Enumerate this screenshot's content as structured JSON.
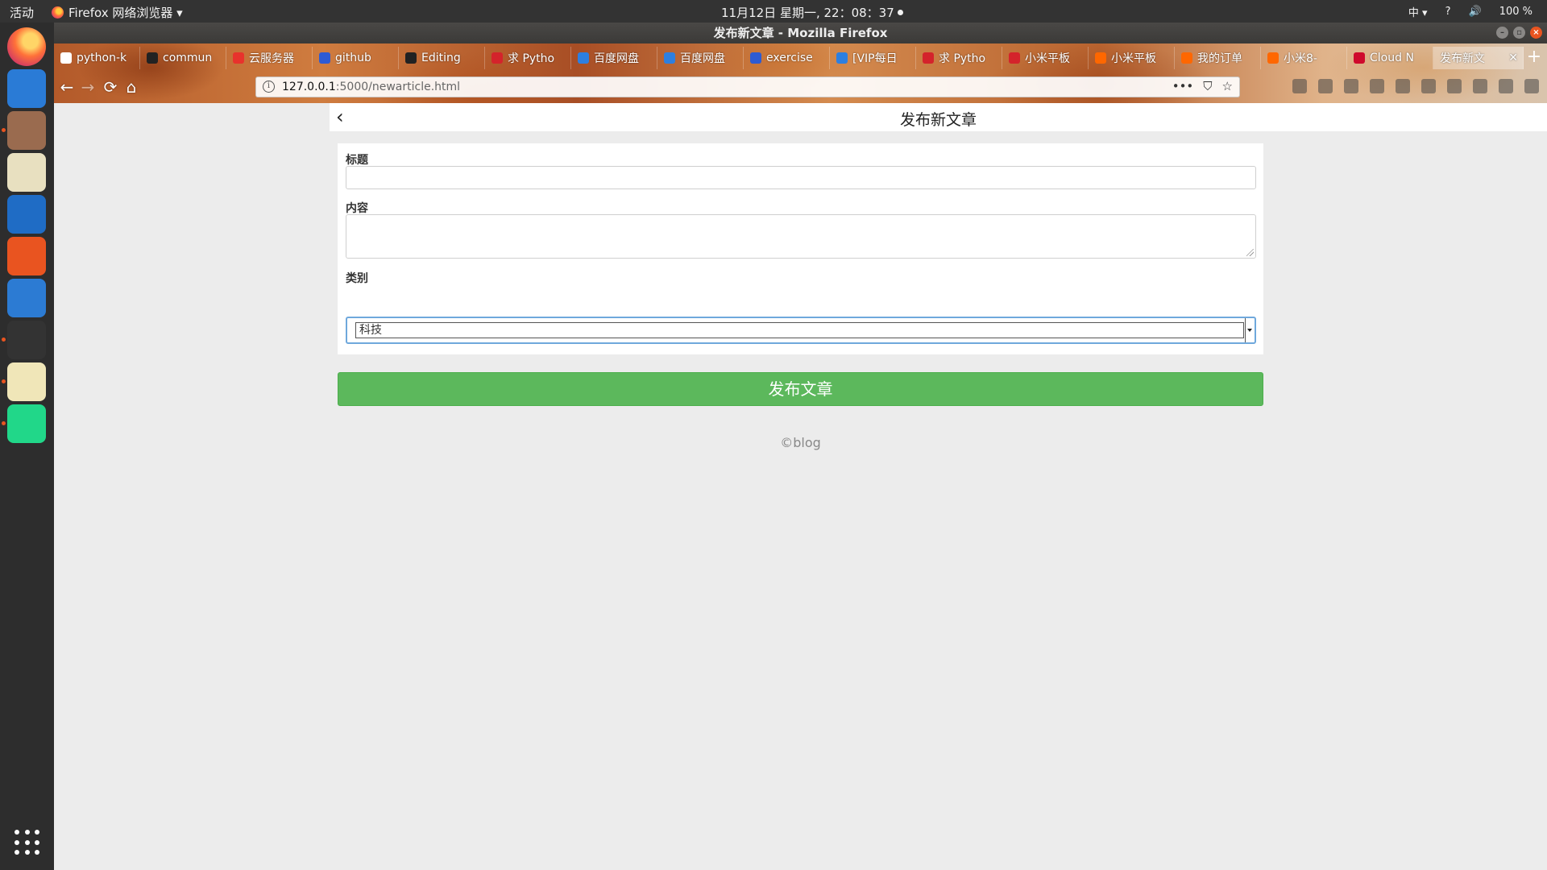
{
  "topbar": {
    "activities": "活动",
    "app_menu": "Firefox 网络浏览器 ▾",
    "clock": "11月12日 星期一, 22：08：37",
    "input_method": "中 ▾",
    "help": "?",
    "volume": "🔊",
    "battery": "100 %"
  },
  "window": {
    "title": "发布新文章 - Mozilla Firefox"
  },
  "tabs": [
    {
      "label": "python-k",
      "favicon_color": "#ffffff"
    },
    {
      "label": "commun",
      "favicon_color": "#222222"
    },
    {
      "label": "云服务器",
      "favicon_color": "#e8322c"
    },
    {
      "label": "github",
      "favicon_color": "#2d5bd3"
    },
    {
      "label": "Editing",
      "favicon_color": "#222222"
    },
    {
      "label": "求 Pytho",
      "favicon_color": "#d4232b"
    },
    {
      "label": "百度网盘",
      "favicon_color": "#2d7fe0"
    },
    {
      "label": "百度网盘",
      "favicon_color": "#2d7fe0"
    },
    {
      "label": "exercise",
      "favicon_color": "#2d5bd3"
    },
    {
      "label": "[VIP每日",
      "favicon_color": "#2d7fe0"
    },
    {
      "label": "求 Pytho",
      "favicon_color": "#d4232b"
    },
    {
      "label": "小米平板",
      "favicon_color": "#d4232b"
    },
    {
      "label": "小米平板",
      "favicon_color": "#ff6700"
    },
    {
      "label": "我的订单",
      "favicon_color": "#ff6700"
    },
    {
      "label": "小米8-",
      "favicon_color": "#ff6700"
    },
    {
      "label": "Cloud N",
      "favicon_color": "#cf0a2c"
    }
  ],
  "active_tab": {
    "label": "发布新文",
    "close": "✕"
  },
  "new_tab": "+",
  "nav": {
    "back": "←",
    "forward": "→",
    "reload": "⟳",
    "home": "⌂"
  },
  "url": {
    "host": "127.0.0.1",
    "path": ":5000/newarticle.html",
    "info": "i",
    "more": "•••",
    "pocket": "⛉",
    "bookmark": "☆"
  },
  "dock": [
    {
      "name": "firefox",
      "color": "#ff7139",
      "running": false
    },
    {
      "name": "thunderbird",
      "color": "#2a7bd6",
      "running": false
    },
    {
      "name": "files",
      "color": "#9a6b4f",
      "running": true
    },
    {
      "name": "rhythmbox",
      "color": "#e8e0c0",
      "running": false
    },
    {
      "name": "writer",
      "color": "#1f6cc5",
      "running": false
    },
    {
      "name": "software",
      "color": "#e95420",
      "running": false
    },
    {
      "name": "help",
      "color": "#2c7bd3",
      "running": false
    },
    {
      "name": "terminal",
      "color": "#333333",
      "running": true
    },
    {
      "name": "text-editor",
      "color": "#f0e6b8",
      "running": true
    },
    {
      "name": "pycharm",
      "color": "#21d789",
      "running": true
    }
  ],
  "page": {
    "back_glyph": "‹",
    "title": "发布新文章",
    "labels": {
      "title": "标题",
      "content": "内容",
      "category": "类别"
    },
    "fields": {
      "title_value": "",
      "content_value": "",
      "category_selected": "科技"
    },
    "submit_label": "发布文章",
    "footer": "©blog"
  }
}
